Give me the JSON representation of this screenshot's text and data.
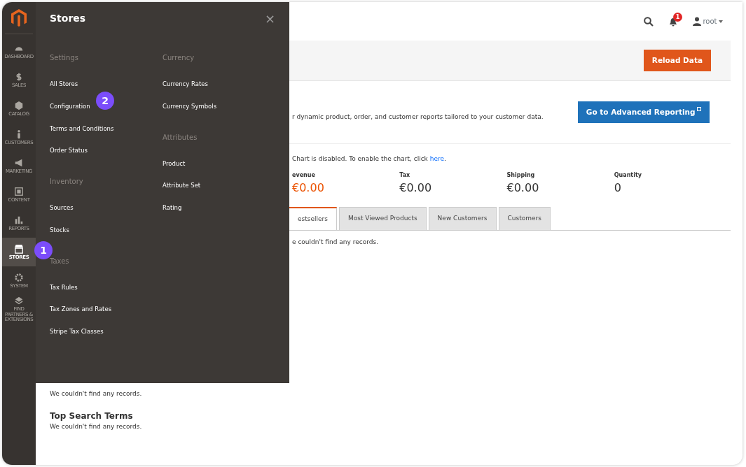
{
  "sidebar": {
    "items": [
      {
        "label": "DASHBOARD",
        "selected": false
      },
      {
        "label": "SALES",
        "selected": false
      },
      {
        "label": "CATALOG",
        "selected": false
      },
      {
        "label": "CUSTOMERS",
        "selected": false
      },
      {
        "label": "MARKETING",
        "selected": false
      },
      {
        "label": "CONTENT",
        "selected": false
      },
      {
        "label": "REPORTS",
        "selected": false
      },
      {
        "label": "STORES",
        "selected": true
      },
      {
        "label": "SYSTEM",
        "selected": false
      },
      {
        "label": "FIND PARTNERS & EXTENSIONS",
        "selected": false
      }
    ]
  },
  "stores_menu": {
    "title": "Stores",
    "close": "×",
    "columns": [
      {
        "groups": [
          {
            "heading": "Settings",
            "items": [
              "All Stores",
              "Configuration",
              "Terms and Conditions",
              "Order Status"
            ]
          },
          {
            "heading": "Inventory",
            "items": [
              "Sources",
              "Stocks"
            ]
          },
          {
            "heading": "Taxes",
            "items": [
              "Tax Rules",
              "Tax Zones and Rates",
              "Stripe Tax Classes"
            ]
          }
        ]
      },
      {
        "groups": [
          {
            "heading": "Currency",
            "items": [
              "Currency Rates",
              "Currency Symbols"
            ]
          },
          {
            "heading": "Attributes",
            "items": [
              "Product",
              "Attribute Set",
              "Rating"
            ]
          }
        ]
      }
    ]
  },
  "step_markers": [
    {
      "label": "1"
    },
    {
      "label": "2"
    }
  ],
  "header": {
    "notification_count": "1",
    "user": "root"
  },
  "reload_button": "Reload Data",
  "advanced_reporting": {
    "text": "r dynamic product, order, and customer reports tailored to your customer data.",
    "button": "Go to Advanced Reporting"
  },
  "chart_notice": {
    "text": "Chart is disabled. To enable the chart, click",
    "link": "here",
    "end": "."
  },
  "totals": [
    {
      "label": "evenue",
      "value": "€0.00",
      "highlight": true
    },
    {
      "label": "Tax",
      "value": "€0.00",
      "highlight": false
    },
    {
      "label": "Shipping",
      "value": "€0.00",
      "highlight": false
    },
    {
      "label": "Quantity",
      "value": "0",
      "highlight": false
    }
  ],
  "tabs": [
    {
      "label": "estsellers",
      "selected": true
    },
    {
      "label": "Most Viewed Products",
      "selected": false
    },
    {
      "label": "New Customers",
      "selected": false
    },
    {
      "label": "Customers",
      "selected": false
    }
  ],
  "tab_content": "e couldn't find any records.",
  "last_search_terms": {
    "empty": "We couldn't find any records."
  },
  "top_search_terms": {
    "title": "Top Search Terms",
    "empty": "We couldn't find any records."
  }
}
